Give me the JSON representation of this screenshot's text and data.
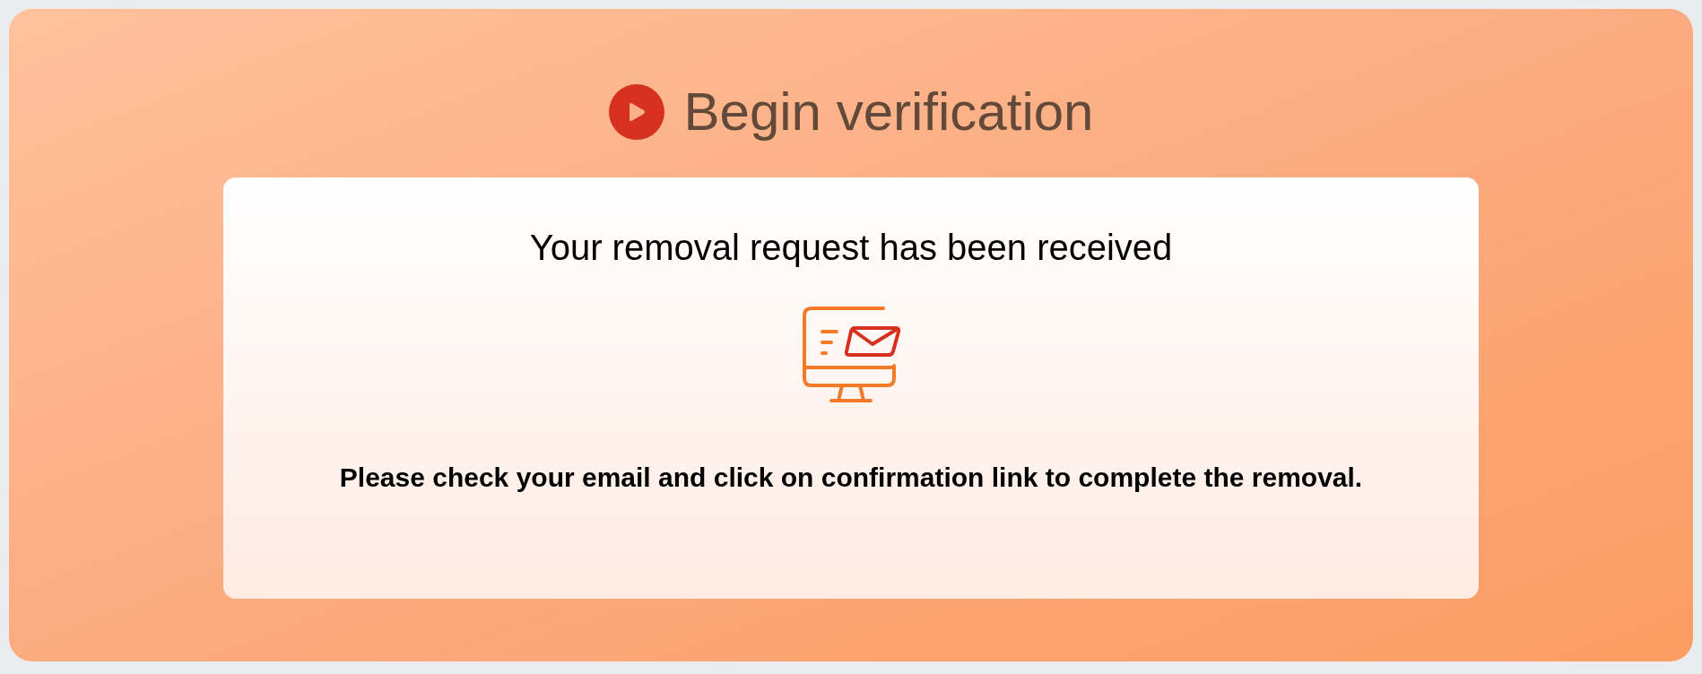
{
  "title": "Begin verification",
  "card": {
    "heading": "Your removal request has been received",
    "message": "Please check your email and click on confirmation link to complete the removal."
  }
}
